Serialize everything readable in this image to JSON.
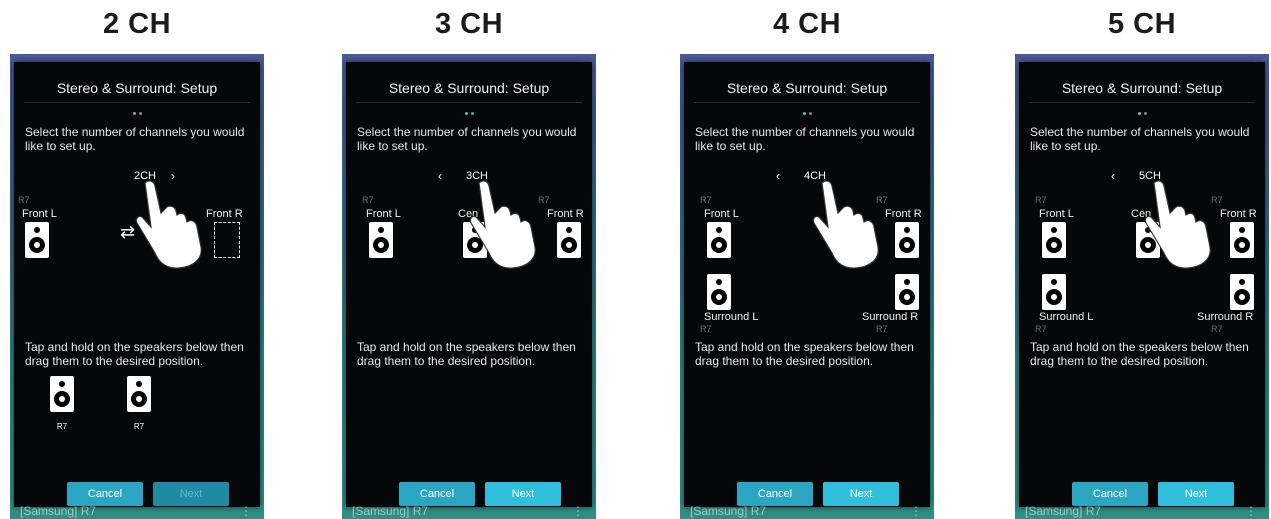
{
  "panels": [
    {
      "heading": "2 CH",
      "dialog_title": "Stereo & Surround: Setup",
      "instruction_top": "Select the number of channels you would like to set up.",
      "channel_value": "2CH",
      "show_left_arrow": false,
      "show_right_arrow": true,
      "speakers": {
        "front_left": "Front L",
        "front_right": "Front R",
        "tag": "R7"
      },
      "instruction_bottom": "Tap and hold on the speakers below then drag them to the desired position.",
      "tray": [
        "R7",
        "R7"
      ],
      "cancel_label": "Cancel",
      "next_label": "Next",
      "next_enabled": false,
      "footer": "[Samsung] R7",
      "footer_menu": "⋮"
    },
    {
      "heading": "3 CH",
      "dialog_title": "Stereo & Surround: Setup",
      "instruction_top": "Select the number of channels you would like to set up.",
      "channel_value": "3CH",
      "speakers": {
        "front_left": "Front L",
        "center": "Cen",
        "front_right": "Front R",
        "tag": "R7"
      },
      "instruction_bottom": "Tap and hold on the speakers below then drag them to the desired position.",
      "cancel_label": "Cancel",
      "next_label": "Next",
      "next_enabled": true,
      "footer": "[Samsung] R7",
      "footer_menu": "⋮"
    },
    {
      "heading": "4 CH",
      "dialog_title": "Stereo & Surround: Setup",
      "instruction_top": "Select the number of channels you would like to set up.",
      "channel_value": "4CH",
      "speakers": {
        "front_left": "Front L",
        "front_right": "Front R",
        "surround_left": "Surround L",
        "surround_right": "Surround R",
        "tag": "R7"
      },
      "instruction_bottom": "Tap and hold on the speakers below then drag them to the desired position.",
      "cancel_label": "Cancel",
      "next_label": "Next",
      "next_enabled": true,
      "footer": "[Samsung] R7",
      "footer_menu": "⋮"
    },
    {
      "heading": "5 CH",
      "dialog_title": "Stereo & Surround: Setup",
      "instruction_top": "Select the number of channels you would like to set up.",
      "channel_value": "5CH",
      "speakers": {
        "front_left": "Front L",
        "center": "Cen",
        "front_right": "Front R",
        "surround_left": "Surround L",
        "surround_right": "Surround R",
        "tag": "R7"
      },
      "instruction_bottom": "Tap and hold on the speakers below then drag them to the desired position.",
      "cancel_label": "Cancel",
      "next_label": "Next",
      "next_enabled": true,
      "footer": "[Samsung] R7",
      "footer_menu": "⋮"
    }
  ],
  "icons": {
    "back": "back-arrow-icon",
    "settings": "gear-icon",
    "speaker": "speaker-icon",
    "hand": "tap-hand-icon",
    "swap": "swap-arrows-icon"
  },
  "colors": {
    "accent": "#2fbfdc",
    "dialog_bg": "#060708",
    "pager_active": "#3fc1dd"
  }
}
